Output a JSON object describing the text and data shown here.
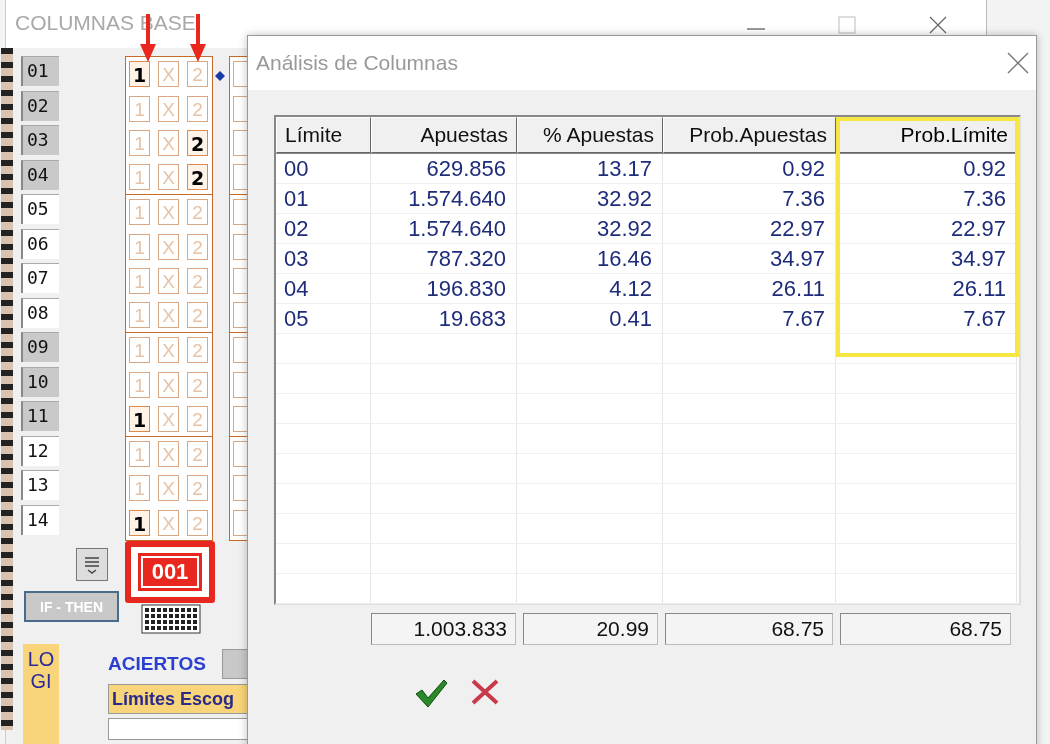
{
  "base_window": {
    "title": "COLUMNAS BASE",
    "rows": [
      {
        "number": "01",
        "shaded": true,
        "picks": [
          {
            "label": "1",
            "marked": true
          },
          {
            "label": "X",
            "marked": false
          },
          {
            "label": "2",
            "marked": false
          }
        ]
      },
      {
        "number": "02",
        "shaded": true,
        "picks": [
          {
            "label": "1",
            "marked": false
          },
          {
            "label": "X",
            "marked": false
          },
          {
            "label": "2",
            "marked": false
          }
        ]
      },
      {
        "number": "03",
        "shaded": true,
        "picks": [
          {
            "label": "1",
            "marked": false
          },
          {
            "label": "X",
            "marked": false
          },
          {
            "label": "2",
            "marked": true
          }
        ]
      },
      {
        "number": "04",
        "shaded": true,
        "picks": [
          {
            "label": "1",
            "marked": false
          },
          {
            "label": "X",
            "marked": false
          },
          {
            "label": "2",
            "marked": true
          }
        ]
      },
      {
        "number": "05",
        "shaded": false,
        "picks": [
          {
            "label": "1",
            "marked": false
          },
          {
            "label": "X",
            "marked": false
          },
          {
            "label": "2",
            "marked": false
          }
        ]
      },
      {
        "number": "06",
        "shaded": false,
        "picks": [
          {
            "label": "1",
            "marked": false
          },
          {
            "label": "X",
            "marked": false
          },
          {
            "label": "2",
            "marked": false
          }
        ]
      },
      {
        "number": "07",
        "shaded": false,
        "picks": [
          {
            "label": "1",
            "marked": false
          },
          {
            "label": "X",
            "marked": false
          },
          {
            "label": "2",
            "marked": false
          }
        ]
      },
      {
        "number": "08",
        "shaded": false,
        "picks": [
          {
            "label": "1",
            "marked": false
          },
          {
            "label": "X",
            "marked": false
          },
          {
            "label": "2",
            "marked": false
          }
        ]
      },
      {
        "number": "09",
        "shaded": true,
        "picks": [
          {
            "label": "1",
            "marked": false
          },
          {
            "label": "X",
            "marked": false
          },
          {
            "label": "2",
            "marked": false
          }
        ]
      },
      {
        "number": "10",
        "shaded": true,
        "picks": [
          {
            "label": "1",
            "marked": false
          },
          {
            "label": "X",
            "marked": false
          },
          {
            "label": "2",
            "marked": false
          }
        ]
      },
      {
        "number": "11",
        "shaded": true,
        "picks": [
          {
            "label": "1",
            "marked": true
          },
          {
            "label": "X",
            "marked": false
          },
          {
            "label": "2",
            "marked": false
          }
        ]
      },
      {
        "number": "12",
        "shaded": false,
        "picks": [
          {
            "label": "1",
            "marked": false
          },
          {
            "label": "X",
            "marked": false
          },
          {
            "label": "2",
            "marked": false
          }
        ]
      },
      {
        "number": "13",
        "shaded": false,
        "picks": [
          {
            "label": "1",
            "marked": false
          },
          {
            "label": "X",
            "marked": false
          },
          {
            "label": "2",
            "marked": false
          }
        ]
      },
      {
        "number": "14",
        "shaded": false,
        "picks": [
          {
            "label": "1",
            "marked": true
          },
          {
            "label": "X",
            "marked": false
          },
          {
            "label": "2",
            "marked": false
          }
        ]
      }
    ],
    "column_number": "001",
    "if_then": "IF - THEN",
    "logic_label": "LOGI",
    "hits_label": "ACIERTOS",
    "limits_label": "Límites Escog"
  },
  "dialog": {
    "title": "Análisis de Columnas",
    "columns": [
      {
        "label": "Límite",
        "highlighted": false
      },
      {
        "label": "Apuestas",
        "highlighted": false
      },
      {
        "label": "% Apuestas",
        "highlighted": false
      },
      {
        "label": "Prob.Apuestas",
        "highlighted": false
      },
      {
        "label": "Prob.Límite",
        "highlighted": true
      }
    ],
    "rows": [
      [
        "00",
        "629.856",
        "13.17",
        "0.92",
        "0.92"
      ],
      [
        "01",
        "1.574.640",
        "32.92",
        "7.36",
        "7.36"
      ],
      [
        "02",
        "1.574.640",
        "32.92",
        "22.97",
        "22.97"
      ],
      [
        "03",
        "787.320",
        "16.46",
        "34.97",
        "34.97"
      ],
      [
        "04",
        "196.830",
        "4.12",
        "26.11",
        "26.11"
      ],
      [
        "05",
        "19.683",
        "0.41",
        "7.67",
        "7.67"
      ]
    ],
    "totals": [
      "1.003.833",
      "20.99",
      "68.75",
      "68.75"
    ]
  }
}
